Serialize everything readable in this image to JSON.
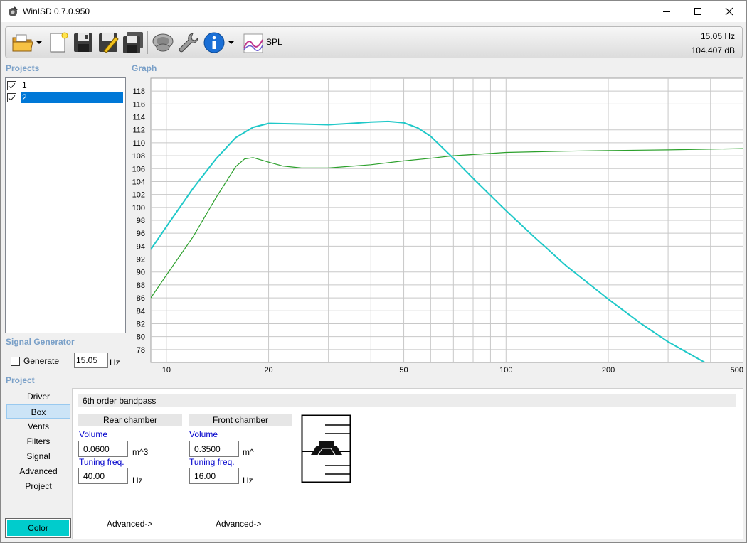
{
  "window": {
    "title": "WinISD 0.7.0.950"
  },
  "toolbar": {
    "items": [
      "open-folder-icon",
      "new-document-icon",
      "save-icon",
      "save-as-icon",
      "save-all-icon",
      "driver-icon",
      "wrench-icon",
      "info-icon",
      "spl-graph-icon"
    ],
    "spl_label": "SPL",
    "readout_hz": "15.05 Hz",
    "readout_db": "104.407 dB"
  },
  "projects": {
    "label": "Projects",
    "items": [
      {
        "label": "1",
        "checked": true,
        "selected": false
      },
      {
        "label": "2",
        "checked": true,
        "selected": true
      }
    ]
  },
  "graph": {
    "label": "Graph"
  },
  "signal_generator": {
    "label": "Signal Generator",
    "generate_label": "Generate",
    "generate_checked": false,
    "frequency": "15.05",
    "unit": "Hz"
  },
  "project": {
    "label": "Project",
    "nav": [
      "Driver",
      "Box",
      "Vents",
      "Filters",
      "Signal",
      "Advanced",
      "Project"
    ],
    "active": "Box",
    "color_button": "Color"
  },
  "box": {
    "type": "6th order bandpass",
    "rear": {
      "header": "Rear chamber",
      "volume_label": "Volume",
      "volume": "0.0600",
      "volume_unit": "m^3",
      "tuning_label": "Tuning freq.",
      "tuning": "40.00",
      "tuning_unit": "Hz",
      "advanced": "Advanced->"
    },
    "front": {
      "header": "Front chamber",
      "volume_label": "Volume",
      "volume": "0.3500",
      "volume_unit": "m^",
      "tuning_label": "Tuning freq.",
      "tuning": "16.00",
      "tuning_unit": "Hz",
      "advanced": "Advanced->"
    }
  },
  "chart_data": {
    "type": "line",
    "xscale": "log",
    "xlim": [
      9,
      500
    ],
    "ylim": [
      76,
      120
    ],
    "xticks": [
      10,
      20,
      50,
      100,
      200,
      500
    ],
    "yticks": [
      78,
      80,
      82,
      84,
      86,
      88,
      90,
      92,
      94,
      96,
      98,
      100,
      102,
      104,
      106,
      108,
      110,
      112,
      114,
      116,
      118
    ],
    "grid": true,
    "series": [
      {
        "color": "#1fc8c8",
        "x": [
          9,
          10,
          12,
          14,
          16,
          18,
          20,
          25,
          30,
          35,
          40,
          45,
          50,
          55,
          60,
          70,
          80,
          100,
          120,
          150,
          200,
          250,
          300,
          400,
          460
        ],
        "y": [
          93.5,
          97.0,
          103.0,
          107.5,
          110.8,
          112.4,
          113.0,
          112.9,
          112.8,
          113.0,
          113.2,
          113.3,
          113.1,
          112.3,
          111.0,
          107.6,
          104.5,
          99.5,
          95.6,
          91.0,
          85.8,
          82.0,
          79.2,
          75.5,
          73.2
        ]
      },
      {
        "color": "#2ca02c",
        "x": [
          9,
          10,
          12,
          14,
          16,
          17,
          18,
          20,
          22,
          25,
          30,
          40,
          50,
          60,
          70,
          100,
          150,
          200,
          300,
          500
        ],
        "y": [
          86.0,
          89.5,
          95.5,
          101.5,
          106.3,
          107.5,
          107.7,
          107.0,
          106.4,
          106.1,
          106.1,
          106.6,
          107.2,
          107.6,
          108.0,
          108.5,
          108.7,
          108.8,
          108.9,
          109.1
        ]
      }
    ]
  }
}
